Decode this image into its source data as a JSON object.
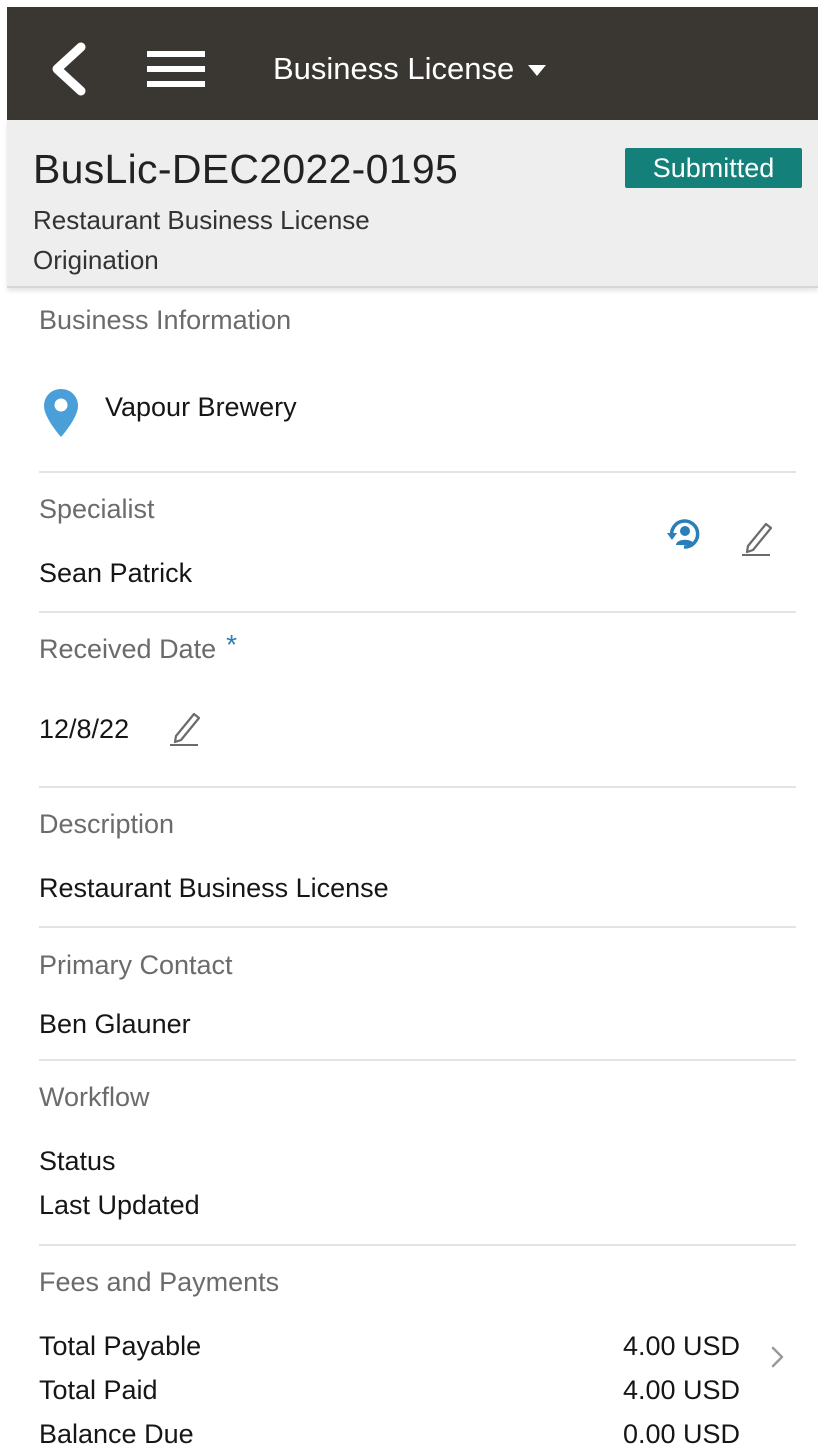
{
  "app": {
    "title": "Business License",
    "icons": {
      "back": "chevron-left-icon",
      "menu": "hamburger-menu-icon",
      "title_dropdown": "caret-down-icon"
    }
  },
  "record": {
    "id": "BusLic-DEC2022-0195",
    "subtitle": "Restaurant Business License Origination",
    "status": "Submitted",
    "status_color": "#13807a"
  },
  "business": {
    "label": "Business Information",
    "name": "Vapour Brewery",
    "icon": "location-pin-icon",
    "icon_color": "#4a9fd8"
  },
  "specialist": {
    "label": "Specialist",
    "name": "Sean Patrick",
    "icons": [
      "assign-user-icon",
      "edit-pencil-icon"
    ]
  },
  "received_date": {
    "label": "Received Date",
    "required_marker": "*",
    "value": "12/8/22",
    "icon": "edit-pencil-icon"
  },
  "description": {
    "label": "Description",
    "value": "Restaurant Business License"
  },
  "primary_contact": {
    "label": "Primary Contact",
    "value": "Ben Glauner"
  },
  "workflow": {
    "label": "Workflow",
    "status_label": "Status",
    "last_updated_label": "Last Updated"
  },
  "fees": {
    "label": "Fees and Payments",
    "rows": [
      {
        "label": "Total Payable",
        "amount": "4.00 USD"
      },
      {
        "label": "Total Paid",
        "amount": "4.00 USD"
      },
      {
        "label": "Balance Due",
        "amount": "0.00 USD"
      }
    ],
    "icon": "chevron-right-icon"
  },
  "colors": {
    "topbar": "#3a3632",
    "accent": "#2a7fb8"
  }
}
